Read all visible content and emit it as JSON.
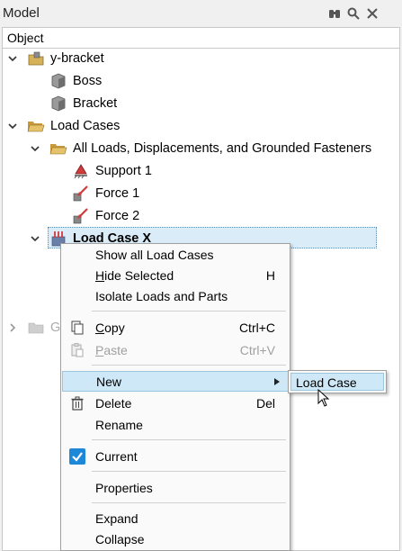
{
  "panel": {
    "title": "Model",
    "toolbar_icons": [
      "binoculars-icon",
      "search-icon",
      "close-icon"
    ],
    "column_header": "Object"
  },
  "tree": {
    "y_bracket": "y-bracket",
    "boss": "Boss",
    "bracket": "Bracket",
    "load_cases": "Load Cases",
    "all_loads": "All Loads, Displacements, and Grounded Fasteners",
    "support_1": "Support 1",
    "force_1": "Force 1",
    "force_2": "Force 2",
    "load_case_x": "Load Case X",
    "hidden_folder": "G"
  },
  "context_menu": {
    "show_all": "Show all Load Cases",
    "hide_selected": "ide Selected",
    "hide_selected_mnemonic": "H",
    "hide_selected_key": "H",
    "isolate": "Isolate Loads and Parts",
    "copy": "opy",
    "copy_mnemonic": "C",
    "copy_key": "Ctrl+C",
    "paste": "aste",
    "paste_mnemonic": "P",
    "paste_key": "Ctrl+V",
    "new": "New",
    "delete": "Delete",
    "delete_key": "Del",
    "rename": "Rename",
    "current": "Current",
    "properties": "Properties",
    "expand": "Expand",
    "collapse": "Collapse"
  },
  "submenu": {
    "load_case": "Load Case"
  },
  "colors": {
    "selection": "#d9ecf8",
    "highlight": "#cfe8f7",
    "check_accent": "#1e88d8"
  }
}
